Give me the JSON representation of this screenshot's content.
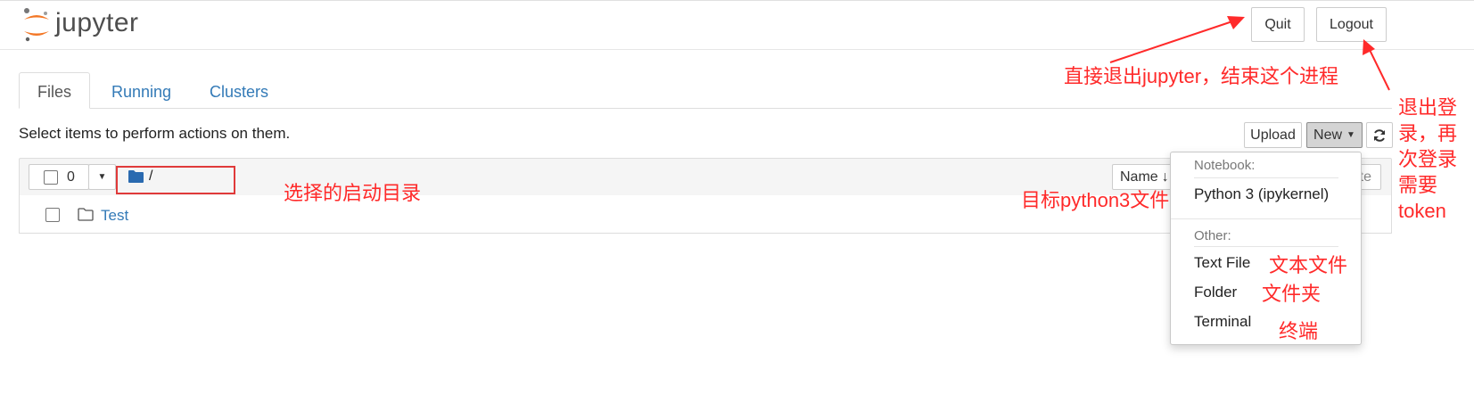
{
  "header": {
    "logo_text": "jupyter",
    "quit_label": "Quit",
    "logout_label": "Logout"
  },
  "tabs": [
    {
      "label": "Files"
    },
    {
      "label": "Running"
    },
    {
      "label": "Clusters"
    }
  ],
  "toolbar": {
    "info_text": "Select items to perform actions on them.",
    "upload_label": "Upload",
    "new_label": "New",
    "refresh_icon": "refresh-icon"
  },
  "list": {
    "selected_count": "0",
    "breadcrumb": "/",
    "sort_label": "Name",
    "last_modified_partial": "te",
    "items": [
      {
        "name": "Test",
        "icon": "folder-icon"
      }
    ]
  },
  "new_menu": {
    "notebook_header": "Notebook:",
    "python_kernel": "Python 3 (ipykernel)",
    "other_header": "Other:",
    "text_file": "Text File",
    "folder": "Folder",
    "terminal": "Terminal"
  },
  "annotations": {
    "quit_note": "直接退出jupyter，结束这个进程",
    "logout_note": [
      "退出登",
      "录，再",
      "次登录",
      "需要",
      "token"
    ],
    "start_dir_note": "选择的启动目录",
    "python_note": "目标python3文件",
    "text_file_note": "文本文件",
    "folder_note": "文件夹",
    "terminal_note": "终端"
  },
  "colors": {
    "link": "#337ab7",
    "annotation": "#ff2a2a",
    "logo_orange": "#f37726"
  }
}
